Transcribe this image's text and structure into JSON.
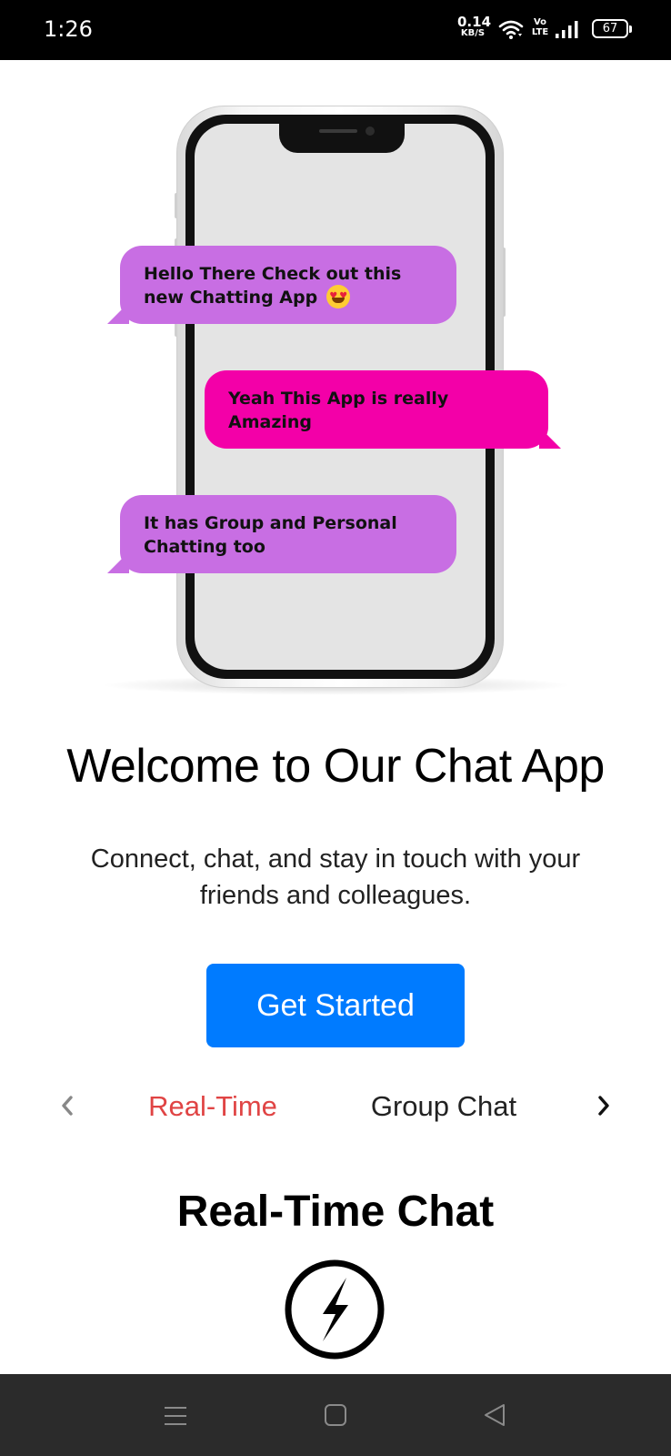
{
  "status_bar": {
    "time": "1:26",
    "net_speed": "0.14",
    "net_speed_unit": "KB/S",
    "volte_top": "Vo",
    "volte_bottom": "LTE",
    "battery": "67",
    "icons": [
      "wifi-icon",
      "signal-icon",
      "battery-icon"
    ]
  },
  "hero": {
    "messages": [
      {
        "text_line1": "Hello There Check out this",
        "text_line2": "new Chatting App",
        "emoji": "smiling-heart-eyes-emoji"
      },
      {
        "text_line1": "Yeah This App is really",
        "text_line2": "Amazing"
      },
      {
        "text_line1": "It has Group and Personal",
        "text_line2": "Chatting too"
      }
    ],
    "colors": {
      "bubble_purple": "#c86ee3",
      "bubble_pink": "#f300a8"
    }
  },
  "welcome": {
    "title": "Welcome to Our Chat App",
    "subtitle_line1": "Connect, chat, and stay in touch with your",
    "subtitle_line2": "friends and colleagues."
  },
  "get_started": {
    "label": "Get Started",
    "color": "#007bff"
  },
  "features": {
    "tabs": [
      {
        "label": "Real-Time",
        "active": true
      },
      {
        "label": "Group Chat",
        "active": false
      }
    ],
    "active_color": "#e04444",
    "current_title": "Real-Time Chat",
    "current_icon": "lightning-bolt-icon"
  },
  "nav_bar": {
    "icons": [
      "menu-icon",
      "home-icon",
      "back-icon"
    ]
  }
}
